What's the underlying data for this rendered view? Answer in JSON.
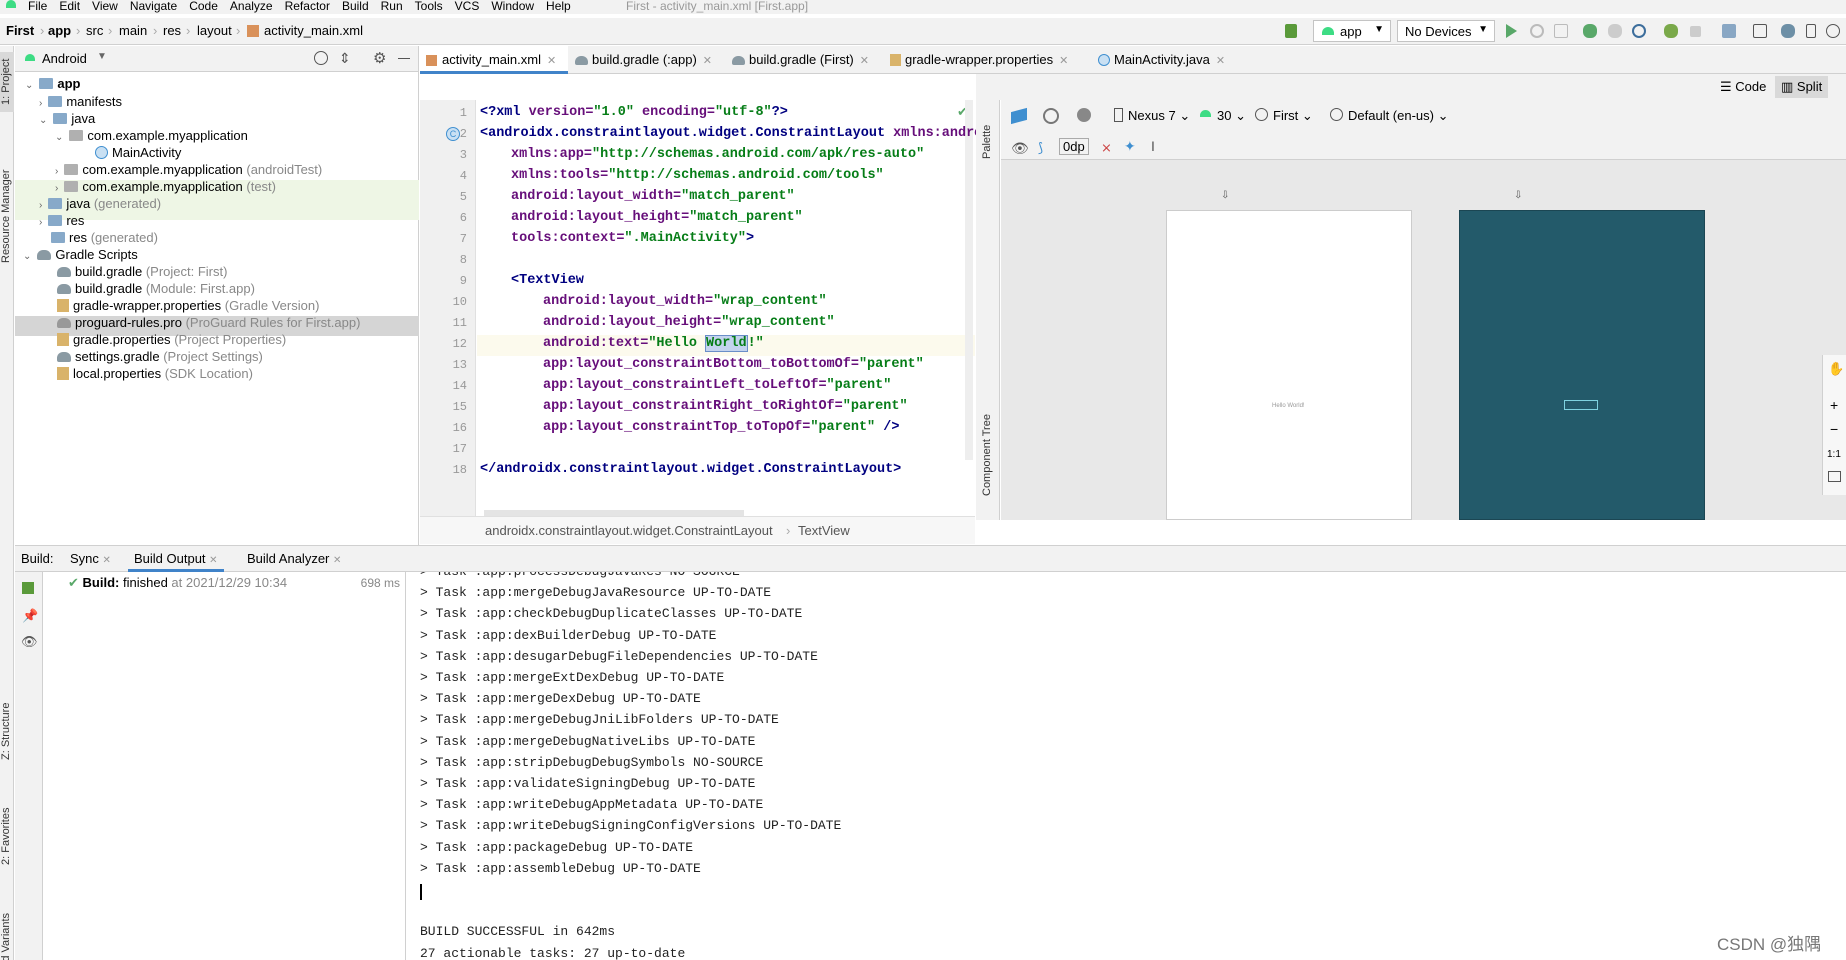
{
  "menu": {
    "items": [
      "File",
      "Edit",
      "View",
      "Navigate",
      "Code",
      "Analyze",
      "Refactor",
      "Build",
      "Run",
      "Tools",
      "VCS",
      "Window",
      "Help"
    ],
    "window_title": "First - activity_main.xml [First.app]"
  },
  "nav": {
    "breadcrumbs": [
      "First",
      "app",
      "src",
      "main",
      "res",
      "layout",
      "activity_main.xml"
    ],
    "run_config": "app",
    "devices": "No Devices"
  },
  "left_stripe": {
    "project": "1: Project",
    "resource_manager": "Resource Manager",
    "structure": "Z: Structure",
    "favorites": "2: Favorites",
    "build_variants": "Build Variants"
  },
  "project": {
    "view_mode": "Android",
    "tree": [
      {
        "label": "app",
        "hint": "",
        "bold": true
      },
      {
        "label": "manifests",
        "hint": ""
      },
      {
        "label": "java",
        "hint": ""
      },
      {
        "label": "com.example.myapplication",
        "hint": ""
      },
      {
        "label": "MainActivity",
        "hint": ""
      },
      {
        "label": "com.example.myapplication",
        "hint": "(androidTest)"
      },
      {
        "label": "com.example.myapplication",
        "hint": "(test)"
      },
      {
        "label": "java",
        "hint": "(generated)"
      },
      {
        "label": "res",
        "hint": ""
      },
      {
        "label": "res",
        "hint": "(generated)"
      },
      {
        "label": "Gradle Scripts",
        "hint": ""
      },
      {
        "label": "build.gradle",
        "hint": "(Project: First)"
      },
      {
        "label": "build.gradle",
        "hint": "(Module: First.app)"
      },
      {
        "label": "gradle-wrapper.properties",
        "hint": "(Gradle Version)"
      },
      {
        "label": "proguard-rules.pro",
        "hint": "(ProGuard Rules for First.app)"
      },
      {
        "label": "gradle.properties",
        "hint": "(Project Properties)"
      },
      {
        "label": "settings.gradle",
        "hint": "(Project Settings)"
      },
      {
        "label": "local.properties",
        "hint": "(SDK Location)"
      }
    ]
  },
  "editor_tabs": [
    "activity_main.xml",
    "build.gradle (:app)",
    "build.gradle (First)",
    "gradle-wrapper.properties",
    "MainActivity.java"
  ],
  "view_modes": {
    "code": "Code",
    "split": "Split"
  },
  "code": {
    "line_numbers": [
      "1",
      "2",
      "3",
      "4",
      "5",
      "6",
      "7",
      "8",
      "9",
      "10",
      "11",
      "12",
      "13",
      "14",
      "15",
      "16",
      "17",
      "18"
    ],
    "l1": {
      "open": "<?xml ",
      "a1": "version=",
      "s1": "\"1.0\"",
      "a2": " encoding=",
      "s2": "\"utf-8\"",
      "close": "?>"
    },
    "l2": {
      "tag": "<androidx.constraintlayout.widget.ConstraintLayout ",
      "attr": "xmlns:andro"
    },
    "l3": {
      "attr": "xmlns:app=",
      "val": "\"http://schemas.android.com/apk/res-auto\""
    },
    "l4": {
      "attr": "xmlns:tools=",
      "val": "\"http://schemas.android.com/tools\""
    },
    "l5": {
      "attr": "android:layout_width=",
      "val": "\"match_parent\""
    },
    "l6": {
      "attr": "android:layout_height=",
      "val": "\"match_parent\""
    },
    "l7": {
      "attr": "tools:context=",
      "val": "\".MainActivity\"",
      "close": ">"
    },
    "l9": {
      "tag": "<TextView"
    },
    "l10": {
      "attr": "android:layout_width=",
      "val": "\"wrap_content\""
    },
    "l11": {
      "attr": "android:layout_height=",
      "val": "\"wrap_content\""
    },
    "l12": {
      "attr": "android:text=",
      "val1": "\"Hello ",
      "sel": "World",
      "val2": "!\""
    },
    "l13": {
      "attr": "app:layout_constraintBottom_toBottomOf=",
      "val": "\"parent\""
    },
    "l14": {
      "attr": "app:layout_constraintLeft_toLeftOf=",
      "val": "\"parent\""
    },
    "l15": {
      "attr": "app:layout_constraintRight_toRightOf=",
      "val": "\"parent\""
    },
    "l16": {
      "attr": "app:layout_constraintTop_toTopOf=",
      "val": "\"parent\"",
      "close": " />"
    },
    "l18": {
      "tag": "</androidx.constraintlayout.widget.ConstraintLayout>"
    }
  },
  "editor_breadcrumb": [
    "androidx.constraintlayout.widget.ConstraintLayout",
    "TextView"
  ],
  "design": {
    "device": "Nexus 7",
    "api": "30",
    "theme": "First",
    "locale": "Default (en-us)",
    "margin": "0dp",
    "palette": "Palette",
    "component_tree": "Component Tree",
    "preview_text": "Hello World!",
    "blueprint_color": "#235a6a"
  },
  "build": {
    "label": "Build:",
    "tabs": [
      "Sync",
      "Build Output",
      "Build Analyzer"
    ],
    "status_title": "Build:",
    "status_text": "finished",
    "status_time": "at 2021/12/29 10:34",
    "duration": "698 ms",
    "output": [
      "> Task :app:processDebugJavaRes NO-SOURCE",
      "> Task :app:mergeDebugJavaResource UP-TO-DATE",
      "> Task :app:checkDebugDuplicateClasses UP-TO-DATE",
      "> Task :app:dexBuilderDebug UP-TO-DATE",
      "> Task :app:desugarDebugFileDependencies UP-TO-DATE",
      "> Task :app:mergeExtDexDebug UP-TO-DATE",
      "> Task :app:mergeDexDebug UP-TO-DATE",
      "> Task :app:mergeDebugJniLibFolders UP-TO-DATE",
      "> Task :app:mergeDebugNativeLibs UP-TO-DATE",
      "> Task :app:stripDebugDebugSymbols NO-SOURCE",
      "> Task :app:validateSigningDebug UP-TO-DATE",
      "> Task :app:writeDebugAppMetadata UP-TO-DATE",
      "> Task :app:writeDebugSigningConfigVersions UP-TO-DATE",
      "> Task :app:packageDebug UP-TO-DATE",
      "> Task :app:assembleDebug UP-TO-DATE",
      "",
      "",
      "BUILD SUCCESSFUL in 642ms",
      "27 actionable tasks: 27 up-to-date"
    ]
  },
  "watermark": "CSDN @独隅"
}
